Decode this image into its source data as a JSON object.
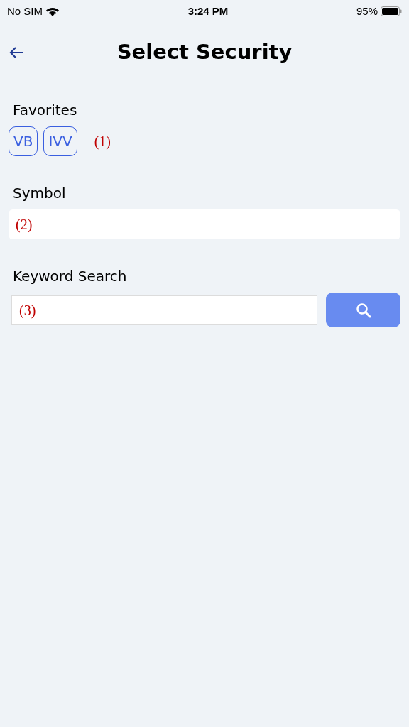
{
  "status_bar": {
    "carrier": "No SIM",
    "time": "3:24 PM",
    "battery": "95%"
  },
  "header": {
    "title": "Select Security"
  },
  "favorites": {
    "label": "Favorites",
    "chips": [
      "VB",
      "IVV"
    ],
    "annotation": "(1)"
  },
  "symbol": {
    "label": "Symbol",
    "annotation": "(2)"
  },
  "keyword_search": {
    "label": "Keyword Search",
    "annotation": "(3)"
  }
}
